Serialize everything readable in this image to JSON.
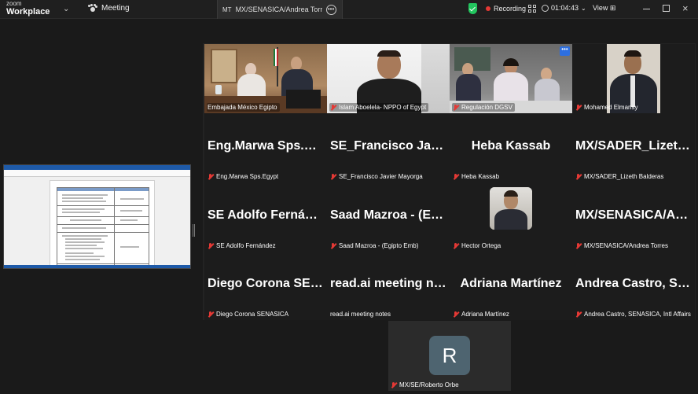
{
  "titlebar": {
    "brand_top": "zoom",
    "brand_bottom": "Workplace",
    "meeting_label": "Meeting",
    "share_badge": "MT",
    "share_title": "MX/SENASICA/Andrea Torres's sc",
    "recording_label": "Recording",
    "timer": "01:04:43",
    "view_label": "View"
  },
  "gallery": {
    "tiles": [
      {
        "display": "",
        "label": "Embajada México Egipto"
      },
      {
        "display": "",
        "label": "Islam Aboelela- NPPO of Egypt"
      },
      {
        "display": "",
        "label": "Regulación DGSV"
      },
      {
        "display": "",
        "label": "Mohamed Elmansy"
      },
      {
        "display": "Eng.Marwa Sps.Egypt",
        "label": "Eng.Marwa Sps.Egypt"
      },
      {
        "display": "SE_Francisco Javier Mayorga",
        "label": "SE_Francisco Javier Mayorga"
      },
      {
        "display": "Heba Kassab",
        "label": "Heba Kassab"
      },
      {
        "display": "MX/SADER_Lizeth Balderas",
        "label": "MX/SADER_Lizeth Balderas"
      },
      {
        "display": "SE Adolfo Fernández",
        "label": "SE Adolfo Fernández"
      },
      {
        "display": "Saad Mazroa - (Egipto Emb)",
        "label": "Saad Mazroa - (Egipto Emb)"
      },
      {
        "display": "",
        "label": "Hector Ortega"
      },
      {
        "display": "MX/SENASICA/Andrea Torres",
        "label": "MX/SENASICA/Andrea Torres"
      },
      {
        "display": "Diego Corona SENASICA",
        "label": "Diego Corona SENASICA"
      },
      {
        "display": "read.ai meeting notes",
        "label": "read.ai meeting notes"
      },
      {
        "display": "Adriana Martínez",
        "label": "Adriana Martínez"
      },
      {
        "display": "Andrea Castro, SENASICA, Intl Affairs",
        "label": "Andrea Castro, SENASICA, Intl Affairs"
      }
    ]
  },
  "self_view": {
    "initial": "R",
    "label": "MX/SE/Roberto Orbe"
  },
  "colors": {
    "active_speaker": "#39c46a",
    "mute": "#e53935",
    "accent": "#2d6fe0"
  }
}
